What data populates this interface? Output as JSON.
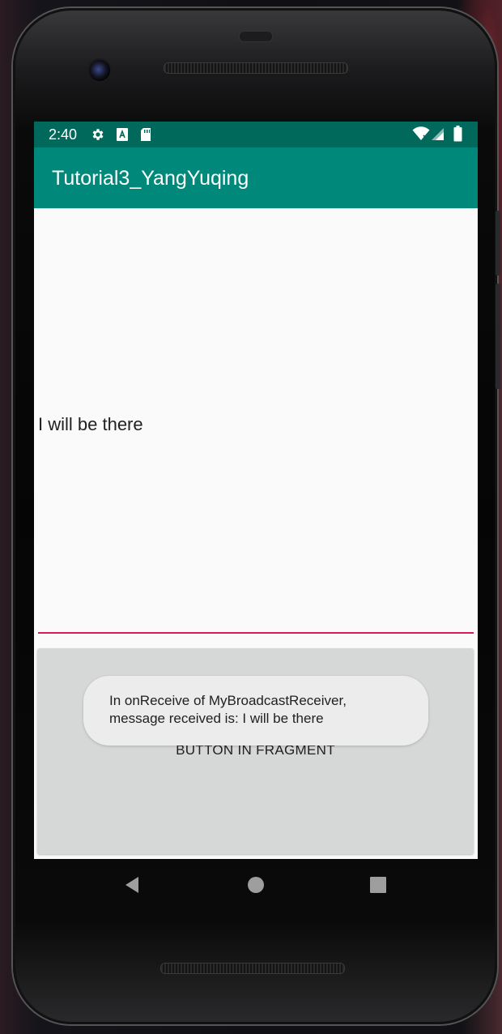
{
  "status_bar": {
    "time": "2:40",
    "icons_left": [
      "settings-icon",
      "a-notification-icon",
      "sd-card-icon"
    ],
    "icons_right": [
      "wifi-icon",
      "signal-icon",
      "battery-icon"
    ]
  },
  "app_bar": {
    "title": "Tutorial3_YangYuqing"
  },
  "main": {
    "message_text": "I will be there",
    "fragment_button_label": "BUTTON IN FRAGMENT"
  },
  "toast": {
    "text": "In onReceive of MyBroadcastReceiver,\nmessage received is: I will be there"
  },
  "nav_bar": {
    "buttons": [
      "back-icon",
      "home-icon",
      "recents-icon"
    ]
  },
  "colors": {
    "status_bar": "#00695c",
    "app_bar": "#00897b",
    "accent": "#d81b60",
    "background": "#fafafa",
    "fragment_button": "#d6d7d7",
    "toast": "#ececec"
  }
}
